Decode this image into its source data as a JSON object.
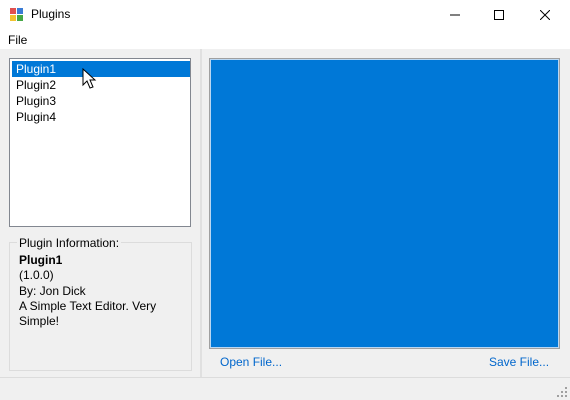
{
  "window": {
    "title": "Plugins"
  },
  "menu": {
    "file_label": "File"
  },
  "plugins": [
    {
      "label": "Plugin1",
      "selected": true
    },
    {
      "label": "Plugin2",
      "selected": false
    },
    {
      "label": "Plugin3",
      "selected": false
    },
    {
      "label": "Plugin4",
      "selected": false
    }
  ],
  "info": {
    "group_title": "Plugin Information:",
    "name": "Plugin1",
    "version": "(1.0.0)",
    "author": "By: Jon Dick",
    "description": "A Simple Text Editor.  Very Simple!"
  },
  "actions": {
    "open_label": "Open File...",
    "save_label": "Save File..."
  },
  "colors": {
    "accent": "#0078d7",
    "link": "#0066cc"
  },
  "icons": {
    "app": "app-icon",
    "minimize": "minimize-icon",
    "maximize": "maximize-icon",
    "close": "close-icon"
  }
}
